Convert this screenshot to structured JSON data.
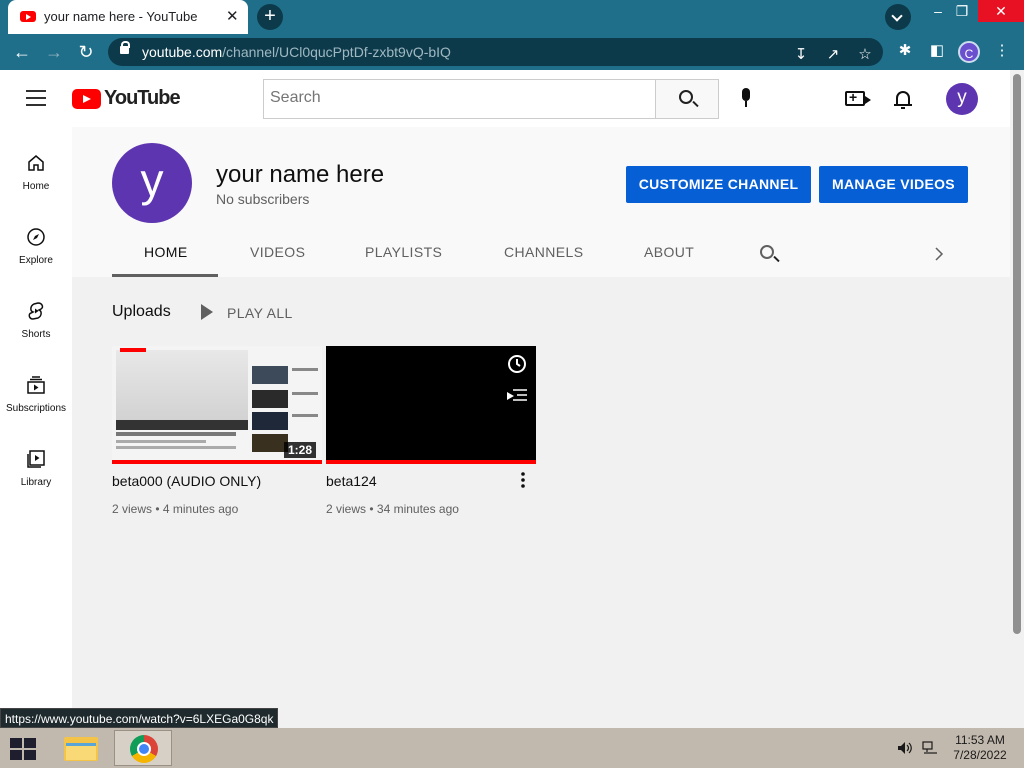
{
  "browser": {
    "tab_title": "your name here - YouTube",
    "tab_close": "✕",
    "new_tab": "+",
    "url_host": "youtube.com",
    "url_path": "/channel/UCl0qucPptDf-zxbt9vQ-bIQ",
    "profile_initial": "C",
    "status_url": "https://www.youtube.com/watch?v=6LXEGa0G8qk",
    "window_controls": {
      "minimize": "–",
      "restore": "❐",
      "close": "✕"
    }
  },
  "youtube": {
    "logo_text": "YouTube",
    "search_placeholder": "Search",
    "avatar_initial": "y",
    "sidebar": [
      {
        "label": "Home",
        "icon": "home-icon"
      },
      {
        "label": "Explore",
        "icon": "compass-icon"
      },
      {
        "label": "Shorts",
        "icon": "shorts-icon"
      },
      {
        "label": "Subscriptions",
        "icon": "subscriptions-icon"
      },
      {
        "label": "Library",
        "icon": "library-icon"
      }
    ],
    "channel": {
      "avatar_initial": "y",
      "name": "your name here",
      "subscribers": "No subscribers",
      "customize_label": "CUSTOMIZE CHANNEL",
      "manage_label": "MANAGE VIDEOS",
      "tabs": [
        "HOME",
        "VIDEOS",
        "PLAYLISTS",
        "CHANNELS",
        "ABOUT"
      ],
      "active_tab": "HOME"
    },
    "uploads": {
      "heading": "Uploads",
      "play_all": "PLAY ALL",
      "videos": [
        {
          "title": "beta000 (AUDIO ONLY)",
          "views": "2 views",
          "age": "4 minutes ago",
          "duration": "1:28",
          "progress": 1.0
        },
        {
          "title": "beta124",
          "views": "2 views",
          "age": "34 minutes ago",
          "duration": "",
          "progress": 1.0
        }
      ]
    }
  },
  "taskbar": {
    "time": "11:53 AM",
    "date": "7/28/2022"
  },
  "colors": {
    "brand_red": "#ff0000",
    "button_blue": "#065fd4",
    "avatar_purple": "#5e35b1",
    "chrome_frame": "#1f6f8b"
  }
}
